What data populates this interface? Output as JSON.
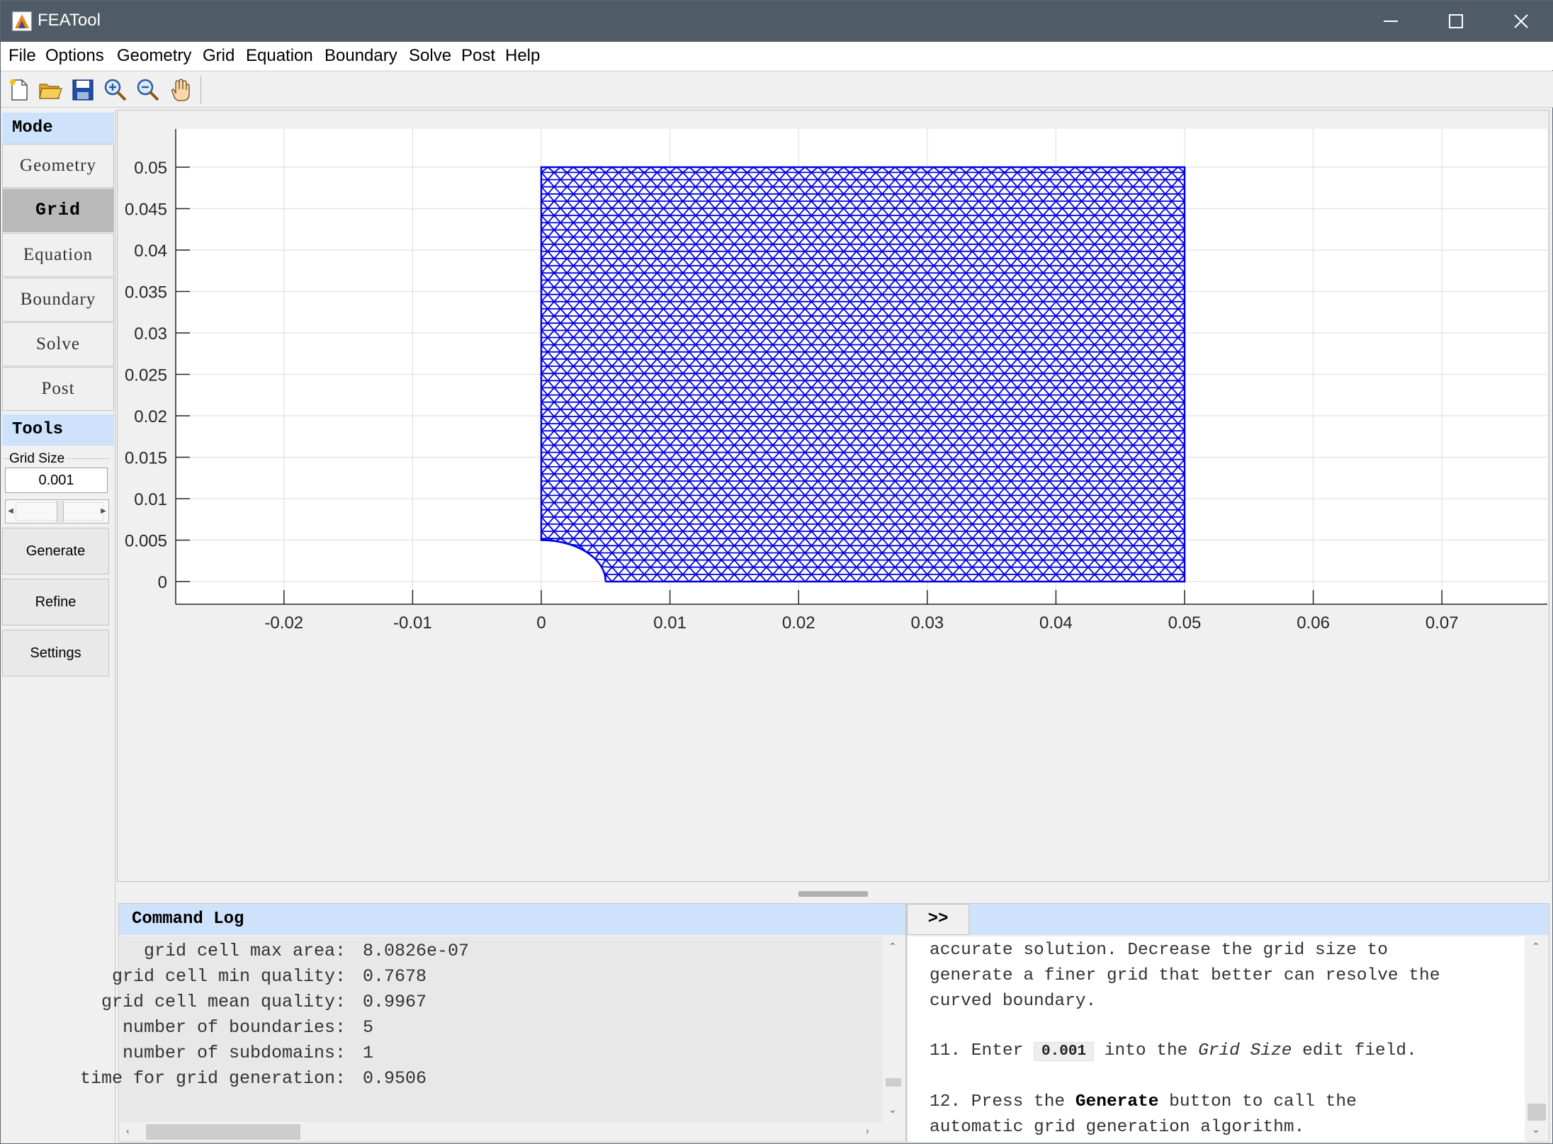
{
  "window": {
    "title": "FEATool",
    "icon": "featool-logo-icon"
  },
  "menu": [
    "File",
    "Options",
    "Geometry",
    "Grid",
    "Equation",
    "Boundary",
    "Solve",
    "Post",
    "Help"
  ],
  "toolbar": [
    {
      "name": "new-file-icon"
    },
    {
      "name": "open-folder-icon"
    },
    {
      "name": "save-icon"
    },
    {
      "name": "zoom-in-icon"
    },
    {
      "name": "zoom-out-icon"
    },
    {
      "name": "pan-hand-icon"
    }
  ],
  "sidebar": {
    "mode_header": "Mode",
    "modes": [
      "Geometry",
      "Grid",
      "Equation",
      "Boundary",
      "Solve",
      "Post"
    ],
    "active_mode": "Grid",
    "tools_header": "Tools",
    "grid_size_label": "Grid Size",
    "grid_size_value": "0.001",
    "slider_level": 0.55,
    "buttons": [
      "Generate",
      "Refine",
      "Settings"
    ]
  },
  "plot": {
    "x_ticks": [
      "-0.02",
      "-0.01",
      "0",
      "0.01",
      "0.02",
      "0.03",
      "0.04",
      "0.05",
      "0.06",
      "0.07"
    ],
    "y_ticks": [
      "0",
      "0.005",
      "0.01",
      "0.015",
      "0.02",
      "0.025",
      "0.03",
      "0.035",
      "0.04",
      "0.045",
      "0.05"
    ],
    "xlim": [
      -0.0285,
      0.0785
    ],
    "ylim": [
      -0.0025,
      0.0525
    ],
    "grid": true,
    "mesh_color": "#0000e6",
    "domain": {
      "x_min": 0,
      "x_max": 0.05,
      "y_min": 0,
      "y_max": 0.05,
      "hole_radius": 0.005
    },
    "grid_size": 0.001
  },
  "command_log": {
    "title": "Command Log",
    "lines": [
      {
        "label": "grid cell max area:",
        "value": "8.0826e-07"
      },
      {
        "label": "grid cell min quality:",
        "value": "0.7678"
      },
      {
        "label": "grid cell mean quality:",
        "value": "0.9967"
      },
      {
        "label": "number of boundaries:",
        "value": "5"
      },
      {
        "label": "number of subdomains:",
        "value": "1"
      },
      {
        "label": "time for grid generation:",
        "value": "0.9506"
      }
    ]
  },
  "tutorial": {
    "expand_label": ">>",
    "line1": "accurate solution. Decrease the grid size to",
    "line2": "generate a finer grid that better can resolve the",
    "line3": "curved boundary.",
    "step11_prefix": "11. Enter",
    "step11_code": "0.001",
    "step11_mid": "into the",
    "step11_em": "Grid Size",
    "step11_suffix": "edit field.",
    "step12_prefix": "12. Press the",
    "step12_bold": "Generate",
    "step12_suffix": "button to call the",
    "line_last": "automatic grid generation algorithm."
  }
}
